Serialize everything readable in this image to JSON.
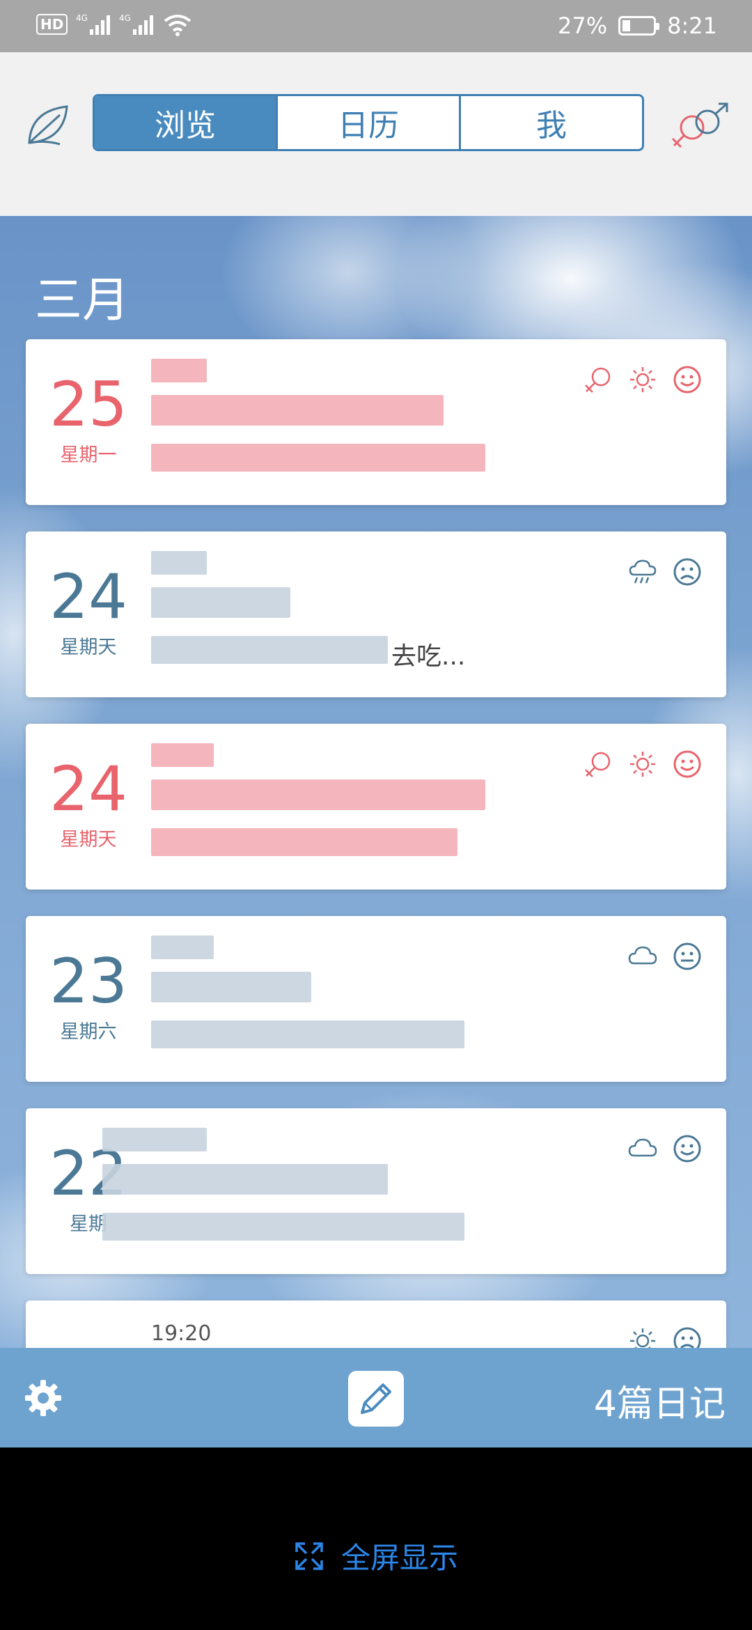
{
  "status": {
    "left_badge": "HD",
    "net1": "4G",
    "net2": "4G",
    "battery_text": "27%",
    "battery_level": 0.27,
    "time": "8:21"
  },
  "tabs": [
    {
      "label": "浏览",
      "active": true
    },
    {
      "label": "日历",
      "active": false
    },
    {
      "label": "我",
      "active": false
    }
  ],
  "month": "三月",
  "entries": [
    {
      "day": "25",
      "weekday": "星期一",
      "color": "pink",
      "time": "",
      "tail": "",
      "icons": [
        "female-icon",
        "sun-icon",
        "smile-icon"
      ]
    },
    {
      "day": "24",
      "weekday": "星期天",
      "color": "blue",
      "time": "",
      "tail": "去吃...",
      "icons": [
        "rain-icon",
        "sad-icon"
      ]
    },
    {
      "day": "24",
      "weekday": "星期天",
      "color": "pink",
      "time": "",
      "tail": "",
      "icons": [
        "female-icon",
        "sun-icon",
        "smile-icon"
      ]
    },
    {
      "day": "23",
      "weekday": "星期六",
      "color": "blue",
      "time": "",
      "tail": "",
      "icons": [
        "cloud-icon",
        "neutral-icon"
      ]
    },
    {
      "day": "22",
      "weekday": "星期",
      "color": "blue",
      "time": "",
      "tail": "",
      "icons": [
        "cloud-icon",
        "smile-icon"
      ]
    },
    {
      "day": "",
      "weekday": "",
      "color": "blue",
      "time": "19:20",
      "tail": "",
      "icons": [
        "sun-icon",
        "sad-icon"
      ]
    }
  ],
  "bottom": {
    "count_label": "4篇日记"
  },
  "navbar": {
    "fullscreen_label": "全屏显示"
  },
  "colors": {
    "accent": "#4a8bbf",
    "pink": "#e8636c",
    "blue": "#4a7895",
    "bottom_bar": "#6fa3cf",
    "fullscreen": "#2b86e8"
  }
}
